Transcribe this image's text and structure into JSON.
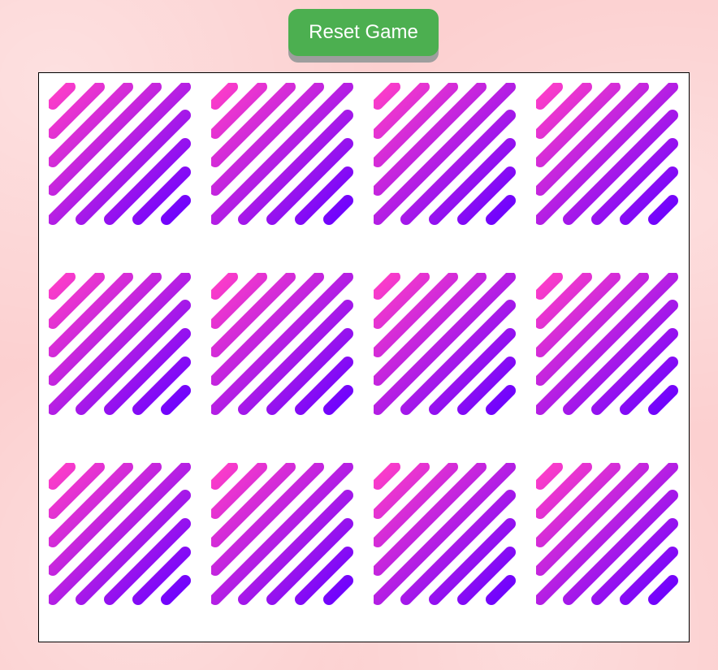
{
  "header": {
    "reset_label": "Reset Game"
  },
  "board": {
    "rows": 3,
    "cols": 4,
    "card_back": {
      "pattern": "diagonal-stripes",
      "gradient_start": "#ff3ec8",
      "gradient_end": "#6a00ff"
    },
    "cards": [
      {
        "state": "face-down"
      },
      {
        "state": "face-down"
      },
      {
        "state": "face-down"
      },
      {
        "state": "face-down"
      },
      {
        "state": "face-down"
      },
      {
        "state": "face-down"
      },
      {
        "state": "face-down"
      },
      {
        "state": "face-down"
      },
      {
        "state": "face-down"
      },
      {
        "state": "face-down"
      },
      {
        "state": "face-down"
      },
      {
        "state": "face-down"
      }
    ]
  },
  "colors": {
    "button": "#4caf50",
    "button_shadow": "#9e9e9e",
    "page_background": "#fcd0d0",
    "board_background": "#ffffff"
  }
}
